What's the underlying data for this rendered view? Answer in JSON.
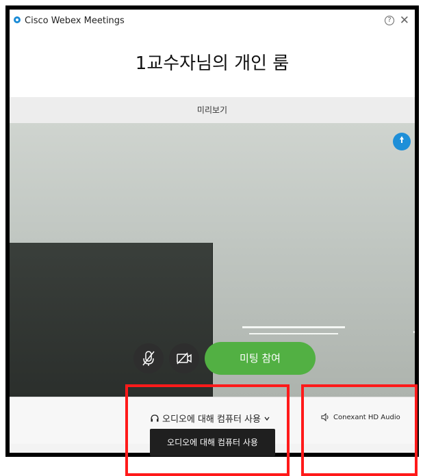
{
  "window": {
    "app_title": "Cisco Webex Meetings",
    "help_glyph": "?",
    "close_glyph": "✕"
  },
  "room": {
    "title": "1교수자님의 개인 룸"
  },
  "preview": {
    "label": "미리보기"
  },
  "controls": {
    "join_label": "미팅 참여",
    "mute_icon": "microphone-muted-icon",
    "camera_icon": "camera-off-icon",
    "pin_icon": "pin-icon"
  },
  "audio": {
    "selector_label": "오디오에 대해 컴퓨터 사용",
    "tooltip": "오디오에 대해 컴퓨터 사용",
    "device_label": "Conexant HD Audio"
  },
  "colors": {
    "accent": "#1e8fd8",
    "join_green": "#52b043",
    "highlight_red": "#ff1a1a"
  }
}
